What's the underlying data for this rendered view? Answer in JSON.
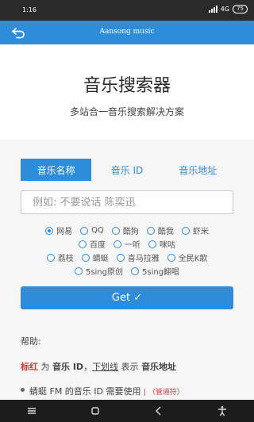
{
  "status_bar": {
    "time": "1:16",
    "network": "4G",
    "battery": "75"
  },
  "app_bar": {
    "title": "Aansong music",
    "back_icon": "back-arrow-icon"
  },
  "hero": {
    "title": "音乐搜索器",
    "subtitle": "多站合一音乐搜索解决方案"
  },
  "tabs": [
    {
      "label": "音乐名称",
      "active": true
    },
    {
      "label": "音乐 ID",
      "active": false
    },
    {
      "label": "音乐地址",
      "active": false
    }
  ],
  "search": {
    "placeholder": "例如: 不要说话 陈奕迅"
  },
  "sources": {
    "rows": [
      [
        "网易",
        "QQ",
        "酷狗",
        "酷我",
        "虾米"
      ],
      [
        "百度",
        "一听",
        "咪咕"
      ],
      [
        "荔枝",
        "蜻蜓",
        "喜马拉雅",
        "全民K歌"
      ],
      [
        "5sing原创",
        "5sing翻唱"
      ]
    ],
    "selected": "网易"
  },
  "get_button": {
    "label": "Get ✓"
  },
  "help": {
    "heading": "帮助:",
    "line1": {
      "red": "标红",
      "t1": " 为 ",
      "id": "音乐 ID",
      "t2": "，",
      "underline": "下划线",
      "t3": " 表示 ",
      "addr": "音乐地址"
    },
    "bullet": {
      "text": "蜻蜓 FM 的音乐 ID 需要使用",
      "pipe": "| （管道符）"
    }
  },
  "colors": {
    "accent": "#2d8ddb",
    "red": "#d9363e"
  },
  "nav_icons": [
    "menu-icon",
    "home-icon",
    "back-icon",
    "accessibility-icon"
  ]
}
